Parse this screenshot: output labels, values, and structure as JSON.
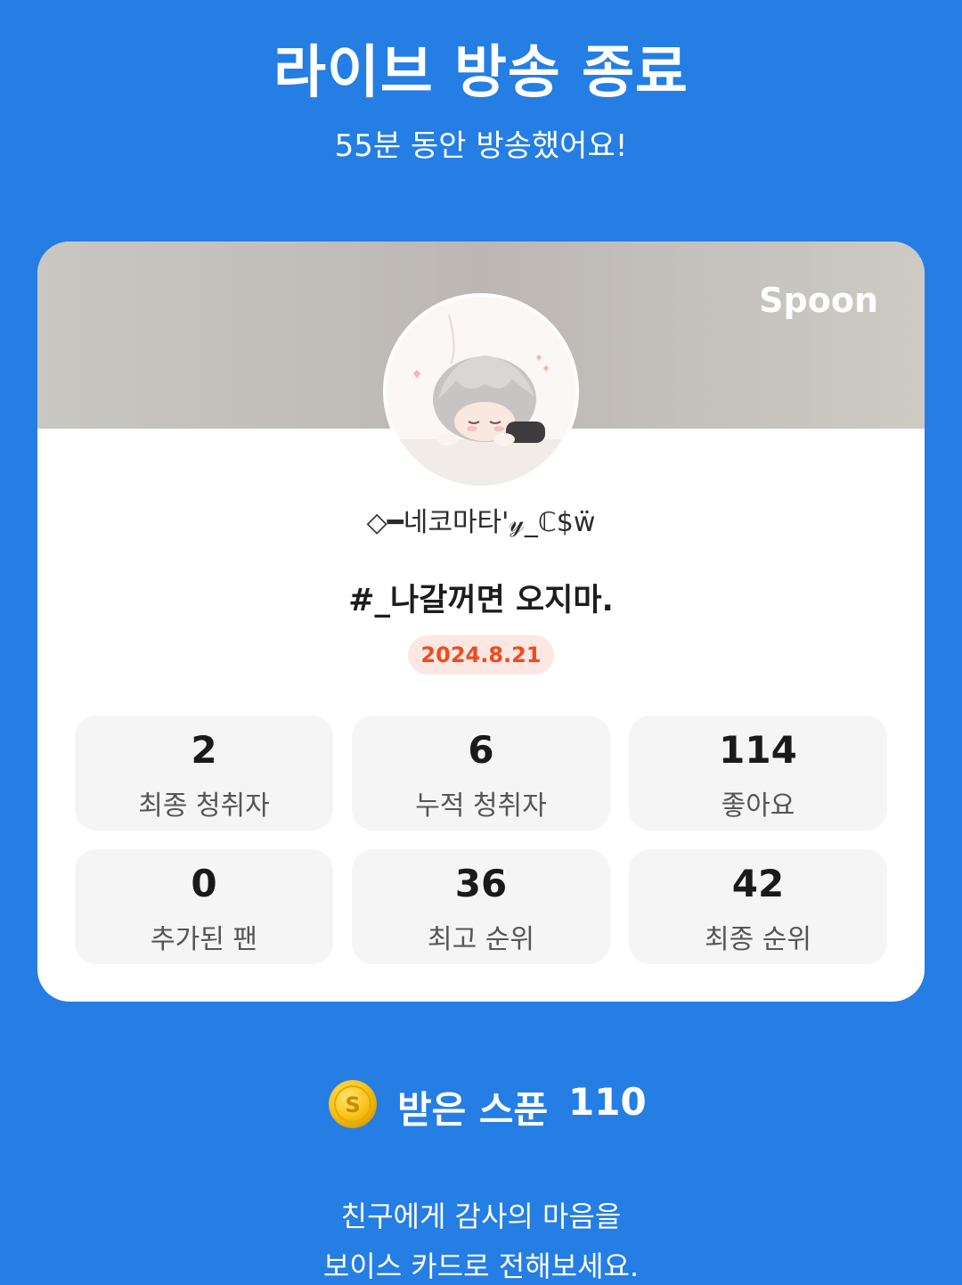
{
  "header": {
    "title": "라이브 방송 종료",
    "subtitle": "55분 동안 방송했어요!"
  },
  "card": {
    "brand": "Spoon",
    "nickname": "◇━네코마타'𝓎_ℂ$ẅ",
    "room_title": "#_나갈꺼면 오지마.",
    "date": "2024.8.21",
    "stats": [
      {
        "value": "2",
        "label": "최종 청취자"
      },
      {
        "value": "6",
        "label": "누적 청취자"
      },
      {
        "value": "114",
        "label": "좋아요"
      },
      {
        "value": "0",
        "label": "추가된 팬"
      },
      {
        "value": "36",
        "label": "최고 순위"
      },
      {
        "value": "42",
        "label": "최종 순위"
      }
    ]
  },
  "spoons": {
    "label": "받은 스푼",
    "count": "110",
    "icon": "coin-icon"
  },
  "message": {
    "line1": "친구에게 감사의 마음을",
    "line2": "보이스 카드로 전해보세요."
  },
  "colors": {
    "background": "#247EE3",
    "date_badge_text": "#EF4B1E",
    "date_badge_bg": "#FDE7E3",
    "stat_bg": "#F5F5F5"
  }
}
